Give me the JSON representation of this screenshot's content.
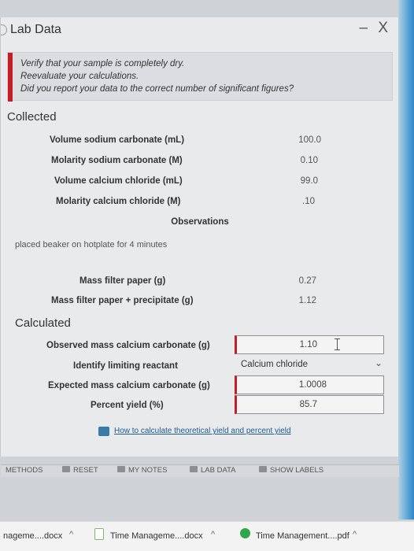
{
  "window": {
    "title": "Lab Data",
    "controls": "– X"
  },
  "alert": {
    "lines": [
      "Verify that your sample is completely dry.",
      "Reevaluate your calculations.",
      "Did you report your data to the correct number of significant figures?"
    ]
  },
  "collected": {
    "heading": "Collected",
    "rows": [
      {
        "label": "Volume sodium carbonate (mL)",
        "value": "100.0"
      },
      {
        "label": "Molarity sodium carbonate (M)",
        "value": "0.10"
      },
      {
        "label": "Volume calcium chloride (mL)",
        "value": "99.0"
      },
      {
        "label": "Molarity calcium chloride (M)",
        "value": ".10"
      }
    ],
    "observations_title": "Observations",
    "observations_text": "placed beaker on hotplate for 4 minutes",
    "mass_rows": [
      {
        "label": "Mass filter paper (g)",
        "value": "0.27"
      },
      {
        "label": "Mass filter paper + precipitate (g)",
        "value": "1.12"
      }
    ]
  },
  "calculated": {
    "heading": "Calculated",
    "observed_mass": {
      "label": "Observed mass calcium carbonate (g)",
      "value": "1.10"
    },
    "limiting_reactant": {
      "label": "Identify limiting reactant",
      "value": "Calcium chloride"
    },
    "expected_mass": {
      "label": "Expected mass calcium carbonate (g)",
      "value": "1.0008"
    },
    "percent_yield": {
      "label": "Percent yield (%)",
      "value": "85.7"
    }
  },
  "help_link": "How to calculate theoretical yield and percent yield",
  "toolbar": {
    "methods": "METHODS",
    "reset": "RESET",
    "my_notes": "MY NOTES",
    "lab_data": "LAB DATA",
    "show_labels": "SHOW LABELS"
  },
  "downloads": [
    {
      "name": "nageme....docx"
    },
    {
      "name": "Time Manageme....docx"
    },
    {
      "name": "Time Management....pdf"
    }
  ],
  "colors": {
    "alert_red": "#c41d24",
    "accent_blue": "#2e86c8",
    "panel_bg": "#e9eaec"
  }
}
